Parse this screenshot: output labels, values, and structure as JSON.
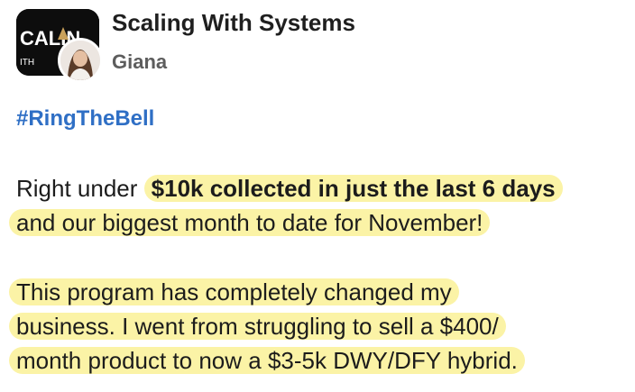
{
  "header": {
    "group_name": "Scaling With Systems",
    "author": "Giana",
    "logo_text": "CALIN",
    "logo_subtext": "ITH"
  },
  "post": {
    "hashtag": "#RingTheBell",
    "paragraph1": {
      "line1_plain": "Right under ",
      "line1_bold": "$10k collected in just the last 6 days",
      "line2": "and our biggest month to date for November!"
    },
    "paragraph2": {
      "line1": "This program has completely changed my",
      "line2": "business. I went from struggling to sell a $400/",
      "line3": "month product to now a $3-5k DWY/DFY hybrid."
    }
  },
  "colors": {
    "hashtag": "#2f6fc5",
    "highlight": "#fbf3a6",
    "logo_bg": "#0d0d0d"
  }
}
